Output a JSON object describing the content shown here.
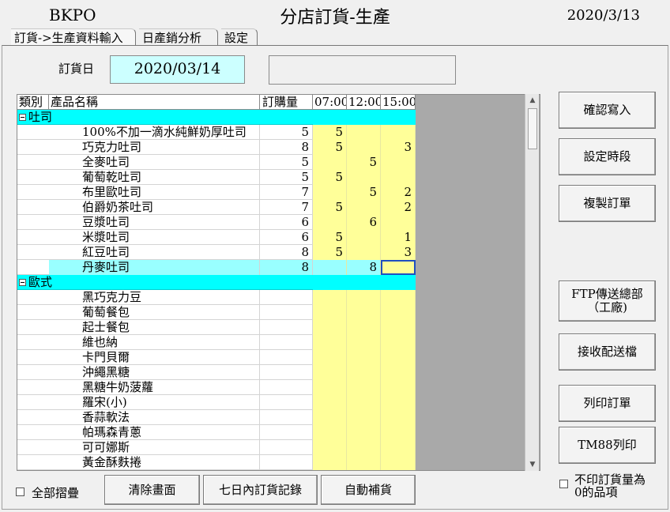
{
  "title": {
    "app": "BKPO",
    "main": "分店訂貨-生產",
    "date": "2020/3/13"
  },
  "tabs": [
    {
      "label": "訂貨->生產資料輸入"
    },
    {
      "label": "日產銷分析"
    },
    {
      "label": "設定"
    }
  ],
  "order_date": {
    "label": "訂貨日",
    "value": "2020/03/14"
  },
  "note_value": "",
  "grid": {
    "columns": [
      "類別",
      "產品名稱",
      "訂購量",
      "07:00",
      "12:00",
      "15:00"
    ],
    "groups": [
      {
        "name": "吐司",
        "rows": [
          {
            "name": "100%不加一滴水純鮮奶厚吐司",
            "qty": "5",
            "h1": "5",
            "h2": "",
            "h3": ""
          },
          {
            "name": "巧克力吐司",
            "qty": "8",
            "h1": "5",
            "h2": "",
            "h3": "3"
          },
          {
            "name": "全麥吐司",
            "qty": "5",
            "h1": "",
            "h2": "5",
            "h3": ""
          },
          {
            "name": "葡萄乾吐司",
            "qty": "5",
            "h1": "5",
            "h2": "",
            "h3": ""
          },
          {
            "name": "布里歐吐司",
            "qty": "7",
            "h1": "",
            "h2": "5",
            "h3": "2"
          },
          {
            "name": "伯爵奶茶吐司",
            "qty": "7",
            "h1": "5",
            "h2": "",
            "h3": "2"
          },
          {
            "name": "豆漿吐司",
            "qty": "6",
            "h1": "",
            "h2": "6",
            "h3": ""
          },
          {
            "name": "米漿吐司",
            "qty": "6",
            "h1": "5",
            "h2": "",
            "h3": "1"
          },
          {
            "name": "紅豆吐司",
            "qty": "8",
            "h1": "5",
            "h2": "",
            "h3": "3"
          },
          {
            "name": "丹麥吐司",
            "qty": "8",
            "h1": "",
            "h2": "8",
            "h3": ""
          }
        ]
      },
      {
        "name": "歐式",
        "rows": [
          {
            "name": "黑巧克力豆",
            "qty": "",
            "h1": "",
            "h2": "",
            "h3": ""
          },
          {
            "name": "葡萄餐包",
            "qty": "",
            "h1": "",
            "h2": "",
            "h3": ""
          },
          {
            "name": "起士餐包",
            "qty": "",
            "h1": "",
            "h2": "",
            "h3": ""
          },
          {
            "name": "維也納",
            "qty": "",
            "h1": "",
            "h2": "",
            "h3": ""
          },
          {
            "name": "卡門貝爾",
            "qty": "",
            "h1": "",
            "h2": "",
            "h3": ""
          },
          {
            "name": "沖繩黑糖",
            "qty": "",
            "h1": "",
            "h2": "",
            "h3": ""
          },
          {
            "name": "黑糖牛奶菠蘿",
            "qty": "",
            "h1": "",
            "h2": "",
            "h3": ""
          },
          {
            "name": "羅宋(小)",
            "qty": "",
            "h1": "",
            "h2": "",
            "h3": ""
          },
          {
            "name": "香蒜軟法",
            "qty": "",
            "h1": "",
            "h2": "",
            "h3": ""
          },
          {
            "name": "帕瑪森青蔥",
            "qty": "",
            "h1": "",
            "h2": "",
            "h3": ""
          },
          {
            "name": "可可娜斯",
            "qty": "",
            "h1": "",
            "h2": "",
            "h3": ""
          },
          {
            "name": "黃金酥麩捲",
            "qty": "",
            "h1": "",
            "h2": "",
            "h3": ""
          }
        ]
      }
    ],
    "selected_row": "丹麥吐司"
  },
  "buttons": {
    "confirm": "確認寫入",
    "set_time": "設定時段",
    "copy_order": "複製訂單",
    "ftp_send": "FTP傳送總部（工廠)",
    "receive": "接收配送檔",
    "print_order": "列印訂單",
    "tm88_print": "TM88列印",
    "clear": "清除畫面",
    "seven_day": "七日內訂貨記錄",
    "auto_refill": "自動補貨"
  },
  "checkboxes": {
    "collapse_all": "全部摺疊",
    "skip_zero": "不印訂貨量為0的品項"
  },
  "colors": {
    "date_bg": "#ccffff",
    "group_row": "#00ffff",
    "time_cell": "#ffff99",
    "selected_row": "#99ffff",
    "grid_bg": "#a9a9a9"
  }
}
